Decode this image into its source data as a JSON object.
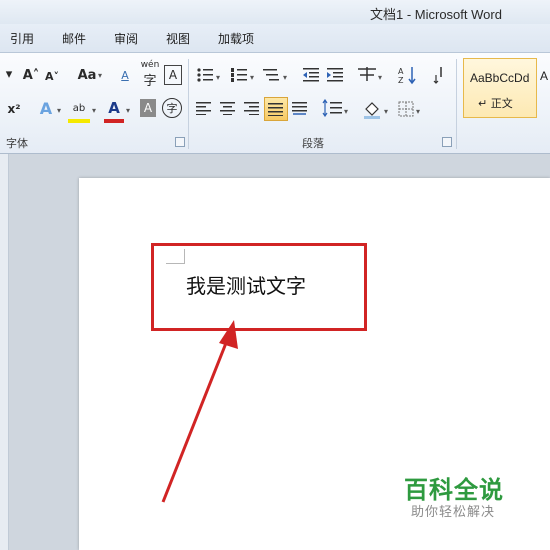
{
  "window": {
    "title": "文档1 - Microsoft Word"
  },
  "tabs": [
    "引用",
    "邮件",
    "审阅",
    "视图",
    "加载项"
  ],
  "ribbon": {
    "groups": {
      "font": "字体",
      "paragraph": "段落"
    },
    "font_buttons": {
      "grow": "A˄",
      "shrink": "A˅",
      "change_case": "Aa",
      "clear_format": "A",
      "phonetic": "wén",
      "char_border": "A",
      "superscript": "x²",
      "text_effect": "A",
      "highlight": "ab",
      "font_color": "A",
      "char_shading": "A",
      "enclose": "字"
    },
    "styles": {
      "normal_preview": "AaBbCcDd",
      "normal_name": "↵ 正文",
      "next_preview": "A"
    }
  },
  "document": {
    "text": "我是测试文字"
  },
  "watermark": {
    "brand": "百科全说",
    "slogan": "助你轻松解决"
  },
  "colors": {
    "annotation_red": "#d12424",
    "watermark_green": "#2e9a3f"
  }
}
